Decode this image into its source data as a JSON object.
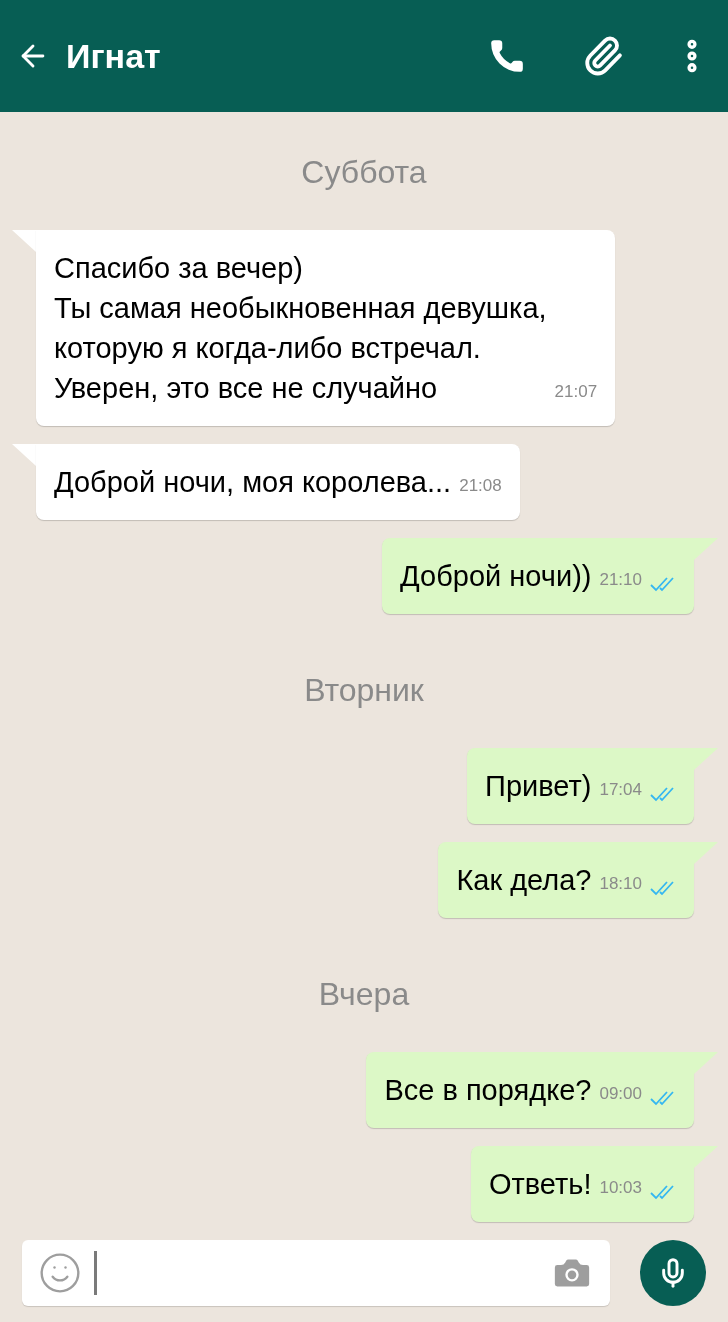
{
  "header": {
    "title": "Игнат"
  },
  "chat": [
    {
      "kind": "day",
      "text": "Суббота"
    },
    {
      "kind": "incoming",
      "text": "Спасибо за вечер)\nТы самая необыкновенная девушка,\nкоторую я когда-либо встречал.\nУверен, это все не случайно",
      "time": "21:07"
    },
    {
      "kind": "incoming",
      "text": "Доброй ночи, моя королева...",
      "time": "21:08"
    },
    {
      "kind": "outgoing",
      "text": "Доброй ночи))",
      "time": "21:10",
      "read": true
    },
    {
      "kind": "day",
      "text": "Вторник"
    },
    {
      "kind": "outgoing",
      "text": "Привет)",
      "time": "17:04",
      "read": true
    },
    {
      "kind": "outgoing",
      "text": "Как дела?",
      "time": "18:10",
      "read": true
    },
    {
      "kind": "day",
      "text": "Вчера"
    },
    {
      "kind": "outgoing",
      "text": "Все в порядке?",
      "time": "09:00",
      "read": true
    },
    {
      "kind": "outgoing",
      "text": "Ответь!",
      "time": "10:03",
      "read": true
    }
  ]
}
